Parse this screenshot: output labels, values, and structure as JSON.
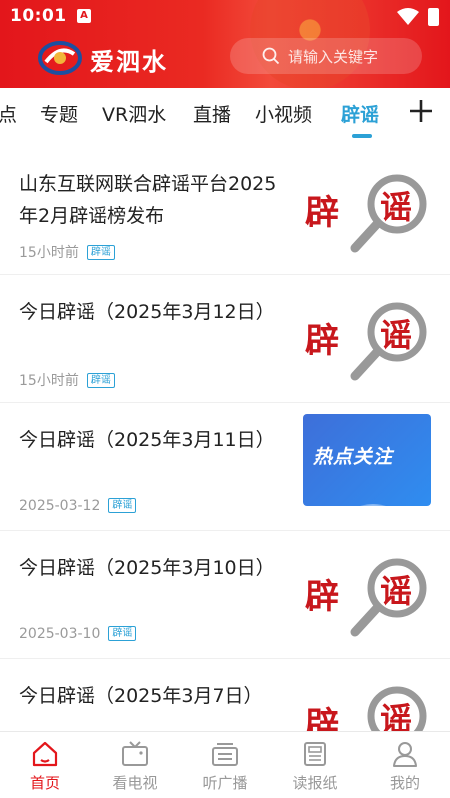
{
  "status_bar": {
    "time": "10:01",
    "notif_badge": "A"
  },
  "header": {
    "brand": "爱泗水",
    "search_placeholder": "请输入关键字"
  },
  "tabs": [
    {
      "label": "点"
    },
    {
      "label": "专题"
    },
    {
      "label": "VR泗水"
    },
    {
      "label": "直播"
    },
    {
      "label": "小视频"
    },
    {
      "label": "辟谣",
      "active": true
    }
  ],
  "articles": [
    {
      "title": "山东互联网联合辟谣平台2025年2月辟谣榜发布",
      "time": "15小时前",
      "tag": "辟谣",
      "thumb": "rumor-magnifier"
    },
    {
      "title": "今日辟谣（2025年3月12日）",
      "time": "15小时前",
      "tag": "辟谣",
      "thumb": "rumor-magnifier"
    },
    {
      "title": "今日辟谣（2025年3月11日）",
      "time": "2025-03-12",
      "tag": "辟谣",
      "thumb": "hot-topic",
      "thumb_text": "热点关注"
    },
    {
      "title": "今日辟谣（2025年3月10日）",
      "time": "2025-03-10",
      "tag": "辟谣",
      "thumb": "rumor-magnifier"
    },
    {
      "title": "今日辟谣（2025年3月7日）",
      "time": "",
      "tag": "",
      "thumb": "rumor-magnifier"
    }
  ],
  "thumb_glyphs": {
    "left": "辟",
    "right": "谣"
  },
  "bottom_nav": [
    {
      "label": "首页",
      "icon": "home-icon",
      "active": true
    },
    {
      "label": "看电视",
      "icon": "tv-icon"
    },
    {
      "label": "听广播",
      "icon": "radio-icon"
    },
    {
      "label": "读报纸",
      "icon": "newspaper-icon"
    },
    {
      "label": "我的",
      "icon": "profile-icon"
    }
  ],
  "colors": {
    "brand_red": "#e3161b",
    "accent_blue": "#2ca1d6",
    "thumb_red": "#c8171c"
  }
}
